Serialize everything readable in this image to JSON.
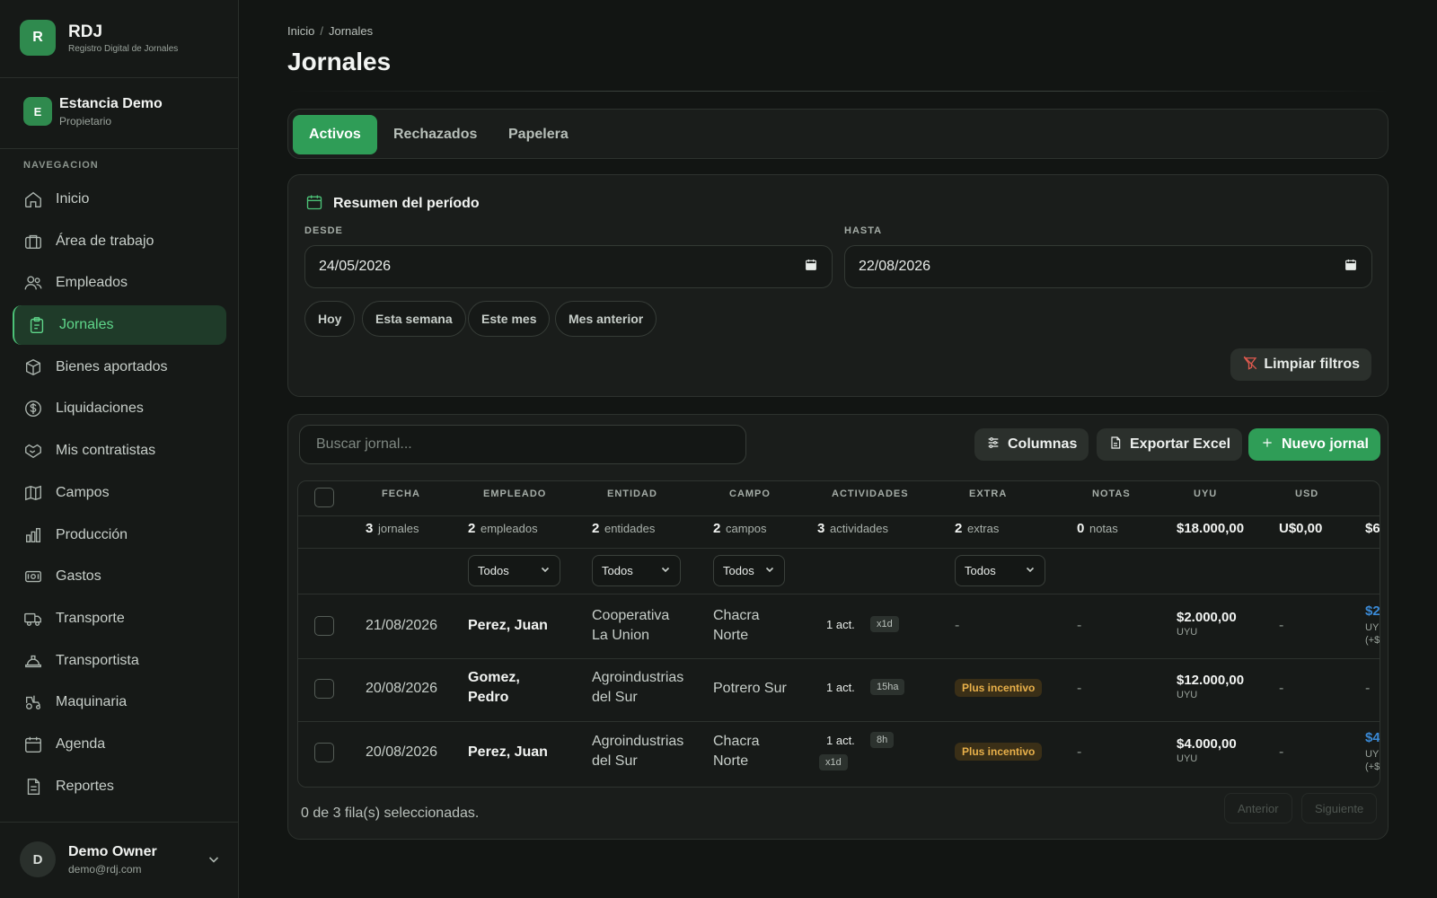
{
  "brand": {
    "logo_letter": "R",
    "name": "RDJ",
    "subtitle": "Registro Digital de Jornales"
  },
  "org": {
    "letter": "E",
    "name": "Estancia Demo",
    "role": "Propietario"
  },
  "nav": {
    "heading": "NAVEGACION",
    "items": [
      {
        "label": "Inicio",
        "icon": "home-icon"
      },
      {
        "label": "Área de trabajo",
        "icon": "briefcase-icon"
      },
      {
        "label": "Empleados",
        "icon": "users-icon"
      },
      {
        "label": "Jornales",
        "icon": "clipboard-icon",
        "active": true
      },
      {
        "label": "Bienes aportados",
        "icon": "package-icon"
      },
      {
        "label": "Liquidaciones",
        "icon": "dollar-circle-icon"
      },
      {
        "label": "Mis contratistas",
        "icon": "handshake-icon"
      },
      {
        "label": "Campos",
        "icon": "map-icon"
      },
      {
        "label": "Producción",
        "icon": "bar-chart-icon"
      },
      {
        "label": "Gastos",
        "icon": "banknote-icon"
      },
      {
        "label": "Transporte",
        "icon": "truck-icon"
      },
      {
        "label": "Transportista",
        "icon": "hard-hat-icon"
      },
      {
        "label": "Maquinaria",
        "icon": "tractor-icon"
      },
      {
        "label": "Agenda",
        "icon": "calendar-icon"
      },
      {
        "label": "Reportes",
        "icon": "file-text-icon"
      }
    ]
  },
  "user": {
    "letter": "D",
    "name": "Demo Owner",
    "email": "demo@rdj.com"
  },
  "breadcrumb": {
    "home": "Inicio",
    "sep": "/",
    "current": "Jornales"
  },
  "page": {
    "title": "Jornales"
  },
  "tabs": [
    {
      "label": "Activos",
      "active": true
    },
    {
      "label": "Rechazados"
    },
    {
      "label": "Papelera"
    }
  ],
  "summary": {
    "title": "Resumen del período",
    "from_label": "DESDE",
    "from_value": "24/05/2026",
    "to_label": "HASTA",
    "to_value": "22/08/2026",
    "quick": [
      "Hoy",
      "Esta semana",
      "Este mes",
      "Mes anterior"
    ],
    "clear_label": "Limpiar filtros"
  },
  "toolbar": {
    "search_placeholder": "Buscar jornal...",
    "columns_label": "Columnas",
    "export_label": "Exportar Excel",
    "new_label": "Nuevo jornal"
  },
  "table": {
    "headers": [
      "FECHA",
      "EMPLEADO",
      "ENTIDAD",
      "CAMPO",
      "ACTIVIDADES",
      "EXTRA",
      "NOTAS",
      "UYU",
      "USD"
    ],
    "summary": {
      "fecha": {
        "n": "3",
        "t": "jornales"
      },
      "empleado": {
        "n": "2",
        "t": "empleados"
      },
      "entidad": {
        "n": "2",
        "t": "entidades"
      },
      "campo": {
        "n": "2",
        "t": "campos"
      },
      "actividades": {
        "n": "3",
        "t": "actividades"
      },
      "extra": {
        "n": "2",
        "t": "extras"
      },
      "notas": {
        "n": "0",
        "t": "notas"
      },
      "uyu": "$18.000,00",
      "usd": "U$0,00",
      "cut": "$6"
    },
    "filters": {
      "empleado": "Todos",
      "entidad": "Todos",
      "campo": "Todos",
      "extra": "Todos"
    },
    "rows": [
      {
        "fecha": "21/08/2026",
        "empleado": [
          "Perez, Juan"
        ],
        "entidad": [
          "Cooperativa",
          "La Union"
        ],
        "campo": [
          "Chacra",
          "Norte"
        ],
        "act": "1 act.",
        "tags": [
          "x1d"
        ],
        "extra": "-",
        "notas": "-",
        "uyu": "$2.000,00",
        "uyu_cur": "UYU",
        "usd": "-",
        "cut_main": "$2",
        "cut_sub": [
          "UY",
          "(+$"
        ]
      },
      {
        "fecha": "20/08/2026",
        "empleado": [
          "Gomez,",
          "Pedro"
        ],
        "entidad": [
          "Agroindustrias",
          "del Sur"
        ],
        "campo": [
          "Potrero Sur"
        ],
        "act": "1 act.",
        "tags": [
          "15ha"
        ],
        "extra": "Plus incentivo",
        "notas": "-",
        "uyu": "$12.000,00",
        "uyu_cur": "UYU",
        "usd": "-",
        "cut_main": "-",
        "cut_sub": []
      },
      {
        "fecha": "20/08/2026",
        "empleado": [
          "Perez, Juan"
        ],
        "entidad": [
          "Agroindustrias",
          "del Sur"
        ],
        "campo": [
          "Chacra",
          "Norte"
        ],
        "act": "1 act.",
        "tags": [
          "8h",
          "x1d"
        ],
        "extra": "Plus incentivo",
        "notas": "-",
        "uyu": "$4.000,00",
        "uyu_cur": "UYU",
        "usd": "-",
        "cut_main": "$4",
        "cut_sub": [
          "UY",
          "(+$"
        ]
      }
    ],
    "selection": "0 de 3 fila(s) seleccionadas.",
    "prev_label": "Anterior",
    "next_label": "Siguiente"
  },
  "colors": {
    "accent": "#2f9d57",
    "active_nav": "#5fd68a",
    "warning": "#e8b04a",
    "link": "#3a8ad6"
  }
}
